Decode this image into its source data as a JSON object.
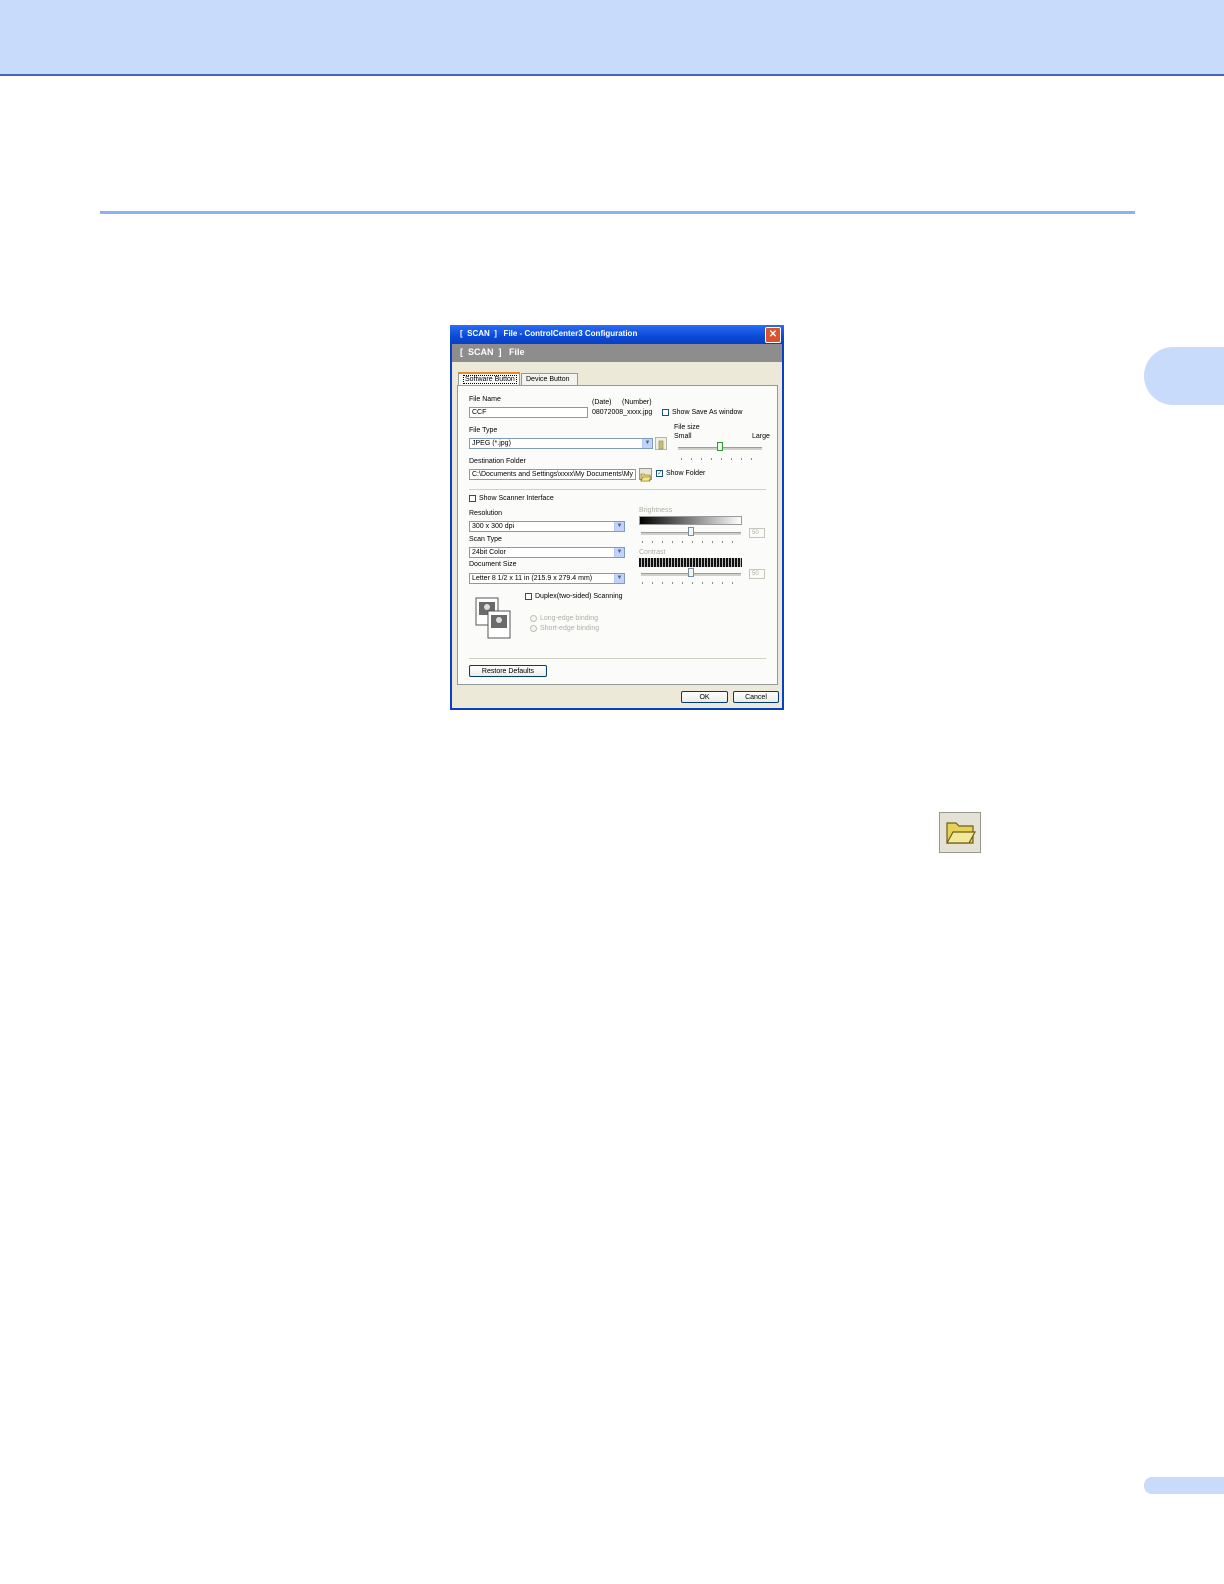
{
  "dialog": {
    "title": "[  SCAN  ]   File - ControlCenter3 Configuration",
    "close_glyph": "✕",
    "header": "[  SCAN  ]   File",
    "tabs": [
      {
        "label": "Software Button",
        "active": true
      },
      {
        "label": "Device Button",
        "active": false
      }
    ],
    "file_name": {
      "label": "File Name",
      "value": "CCF",
      "date_label": "(Date)",
      "number_label": "(Number)",
      "example": "08072008_xxxx.jpg"
    },
    "show_save_as": {
      "label": "Show Save As window",
      "checked": false
    },
    "file_type": {
      "label": "File Type",
      "value": "JPEG (*.jpg)"
    },
    "file_size": {
      "label": "File size",
      "small": "Small",
      "large": "Large",
      "level": 0.5
    },
    "destination": {
      "label": "Destination Folder",
      "value": "C:\\Documents and Settings\\xxxx\\My Documents\\My"
    },
    "show_folder": {
      "label": "Show Folder",
      "checked": true
    },
    "show_scanner_interface": {
      "label": "Show Scanner Interface",
      "checked": false
    },
    "resolution": {
      "label": "Resolution",
      "value": "300 x 300 dpi"
    },
    "scan_type": {
      "label": "Scan Type",
      "value": "24bit Color"
    },
    "document_size": {
      "label": "Document Size",
      "value": "Letter 8 1/2 x 11 in (215.9 x 279.4 mm)"
    },
    "brightness": {
      "label": "Brightness",
      "value": "50",
      "level": 0.5
    },
    "contrast": {
      "label": "Contrast",
      "value": "50",
      "level": 0.5
    },
    "duplex": {
      "label": "Duplex(two-sided) Scanning",
      "checked": false
    },
    "binding": {
      "long": "Long-edge binding",
      "short": "Short-edge binding"
    },
    "restore_defaults": "Restore Defaults",
    "ok": "OK",
    "cancel": "Cancel"
  },
  "colors": {
    "band": "#c9dbfb",
    "title_bar": "#0a4ad7",
    "dialog_bg": "#ece9d8"
  },
  "icons": {
    "folder_button": "open-folder-icon"
  }
}
